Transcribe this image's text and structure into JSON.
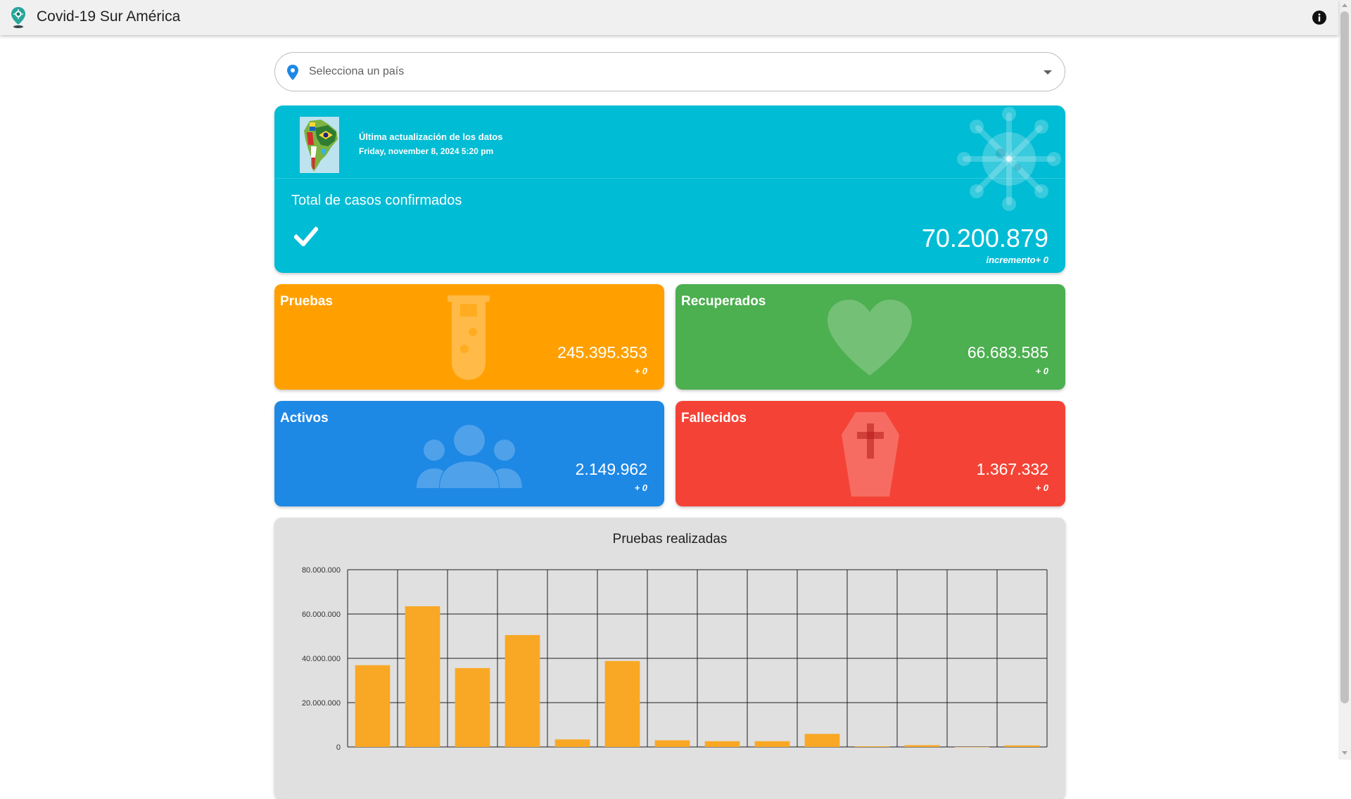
{
  "app": {
    "title": "Covid-19 Sur América"
  },
  "selector": {
    "placeholder": "Selecciona un país"
  },
  "summary": {
    "update_label": "Última actualización de los datos",
    "update_date": "Friday, november 8, 2024 5:20 pm",
    "confirmed_title": "Total de casos confirmados",
    "confirmed_value": "70.200.879",
    "confirmed_increment": "incremento+ 0"
  },
  "stats": {
    "pruebas": {
      "title": "Pruebas",
      "value": "245.395.353",
      "increment": "+ 0",
      "color": "#ffa000"
    },
    "recuperados": {
      "title": "Recuperados",
      "value": "66.683.585",
      "increment": "+ 0",
      "color": "#4caf50"
    },
    "activos": {
      "title": "Activos",
      "value": "2.149.962",
      "increment": "+ 0",
      "color": "#1e88e5"
    },
    "fallecidos": {
      "title": "Fallecidos",
      "value": "1.367.332",
      "increment": "+ 0",
      "color": "#f44336"
    }
  },
  "icons": {
    "app_logo": "virus-pin-icon",
    "info": "info-icon",
    "selector_pin": "map-pin-icon",
    "selector_caret": "caret-down-icon",
    "summary_flag": "south-america-flag-map",
    "summary_virus": "virus-icon",
    "summary_check": "check-icon",
    "pruebas": "test-tube-icon",
    "recuperados": "heart-icon",
    "activos": "people-group-icon",
    "fallecidos": "coffin-icon"
  },
  "chart_data": {
    "type": "bar",
    "title": "Pruebas realizadas",
    "xlabel": "",
    "ylabel": "",
    "ylim": [
      0,
      80000000
    ],
    "ytick_labels": [
      "0",
      "20.000.000",
      "40.000.000",
      "60.000.000",
      "80.000.000"
    ],
    "grid": true,
    "bar_color": "#f9a825",
    "categories": [
      "",
      "",
      "",
      "",
      "",
      "",
      "",
      "",
      "",
      "",
      "",
      "",
      "",
      ""
    ],
    "values": [
      36900000,
      63500000,
      35600000,
      50500000,
      3400000,
      38800000,
      3000000,
      2600000,
      2600000,
      5900000,
      300000,
      800000,
      0,
      700000
    ]
  }
}
